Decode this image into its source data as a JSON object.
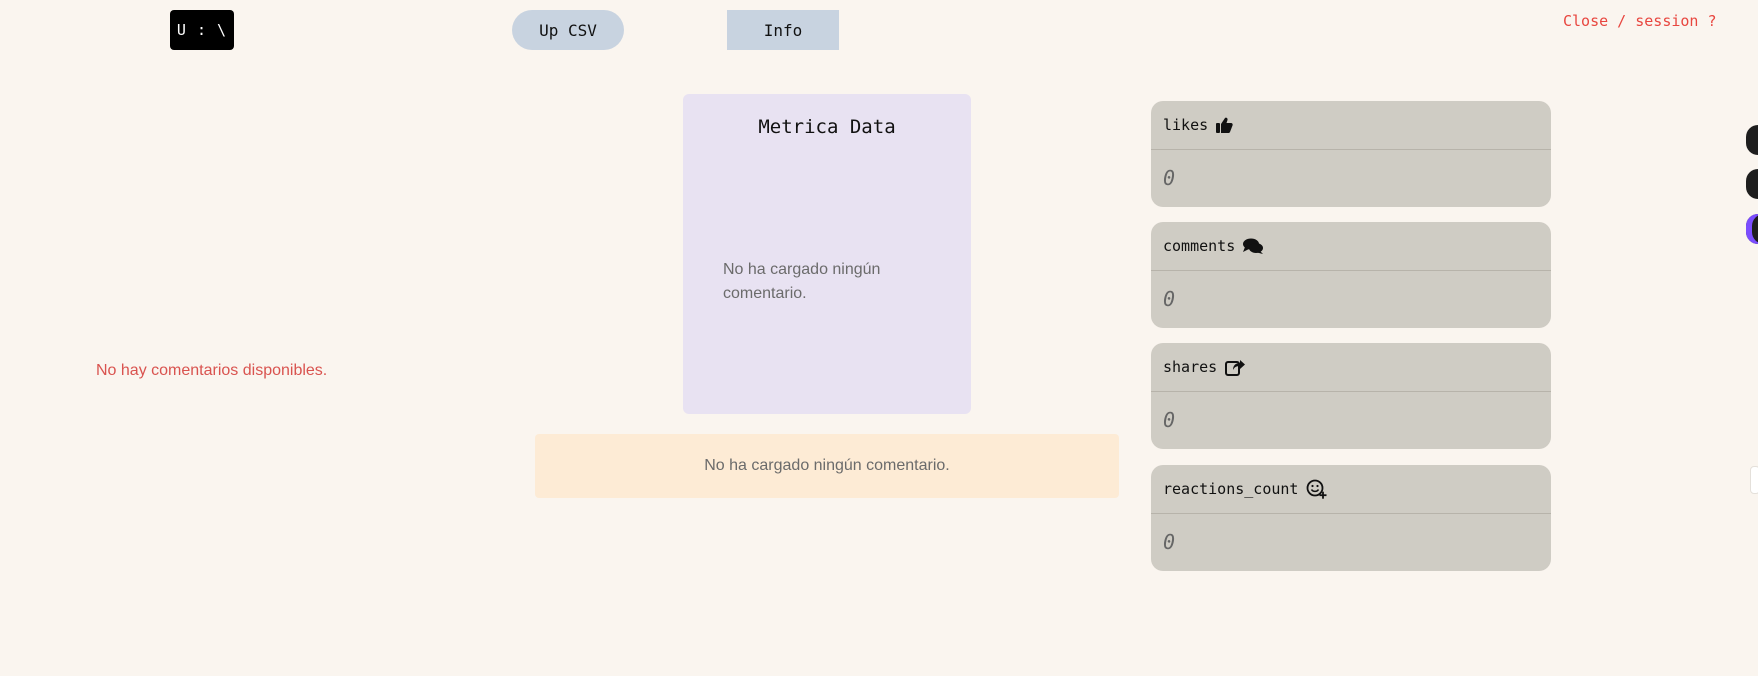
{
  "header": {
    "logo_text": "U : \\",
    "upload_csv_label": "Up CSV",
    "info_label": "Info",
    "close_session_label": "Close / session ?"
  },
  "left_panel": {
    "no_comments_message": "No hay comentarios disponibles."
  },
  "metric_card": {
    "title": "Metrica Data",
    "empty_message": "No ha cargado ningún comentario."
  },
  "alert": {
    "message": "No ha cargado ningún comentario."
  },
  "stats": [
    {
      "label": "likes",
      "icon": "thumbs-up-icon",
      "value": "0"
    },
    {
      "label": "comments",
      "icon": "comments-icon",
      "value": "0"
    },
    {
      "label": "shares",
      "icon": "share-icon",
      "value": "0"
    },
    {
      "label": "reactions_count",
      "icon": "smile-plus-icon",
      "value": "0"
    }
  ],
  "colors": {
    "background": "#faf5ef",
    "accent_red": "#e8463f",
    "button_blue_gray": "#c8d3e0",
    "metric_card_bg": "#e8e2f2",
    "alert_bg": "#fdebd5",
    "stat_card_bg": "#cfccc4"
  }
}
